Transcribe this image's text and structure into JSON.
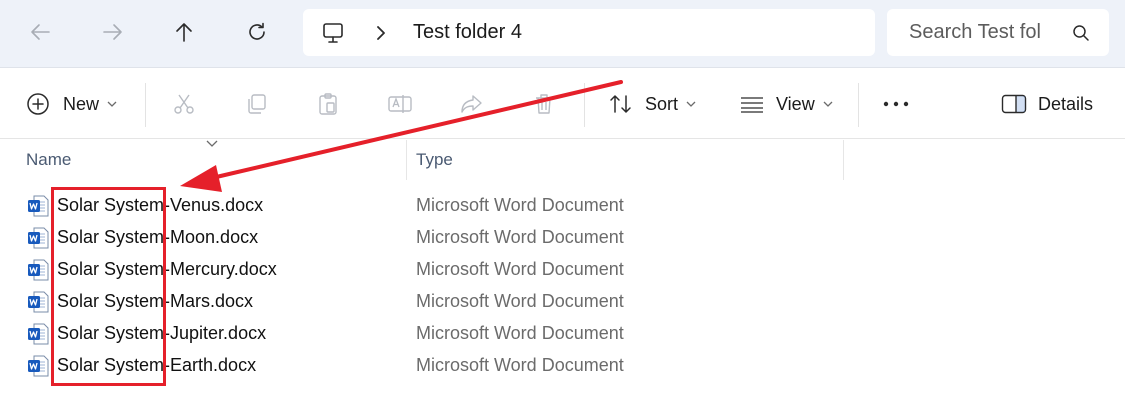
{
  "address_bar": {
    "breadcrumb": "Test folder 4",
    "search_placeholder": "Search Test fol"
  },
  "toolbar": {
    "new_label": "New",
    "sort_label": "Sort",
    "view_label": "View",
    "details_label": "Details"
  },
  "columns": {
    "name": "Name",
    "type": "Type"
  },
  "files": [
    {
      "name": "Solar System-Venus.docx",
      "type": "Microsoft Word Document"
    },
    {
      "name": "Solar System-Moon.docx",
      "type": "Microsoft Word Document"
    },
    {
      "name": "Solar System-Mercury.docx",
      "type": "Microsoft Word Document"
    },
    {
      "name": "Solar System-Mars.docx",
      "type": "Microsoft Word Document"
    },
    {
      "name": "Solar System-Jupiter.docx",
      "type": "Microsoft Word Document"
    },
    {
      "name": "Solar System-Earth.docx",
      "type": "Microsoft Word Document"
    }
  ],
  "colors": {
    "annotation": "#e5202a",
    "word_blue": "#185abd",
    "address_bg": "#eef2f9"
  },
  "icons": [
    "back-arrow-icon",
    "forward-arrow-icon",
    "up-arrow-icon",
    "refresh-icon",
    "this-pc-icon",
    "chevron-right-icon",
    "search-icon",
    "new-plus-icon",
    "cut-icon",
    "copy-icon",
    "paste-icon",
    "rename-icon",
    "share-icon",
    "delete-icon",
    "sort-icon",
    "view-icon",
    "more-icon",
    "details-pane-icon",
    "word-document-icon"
  ]
}
